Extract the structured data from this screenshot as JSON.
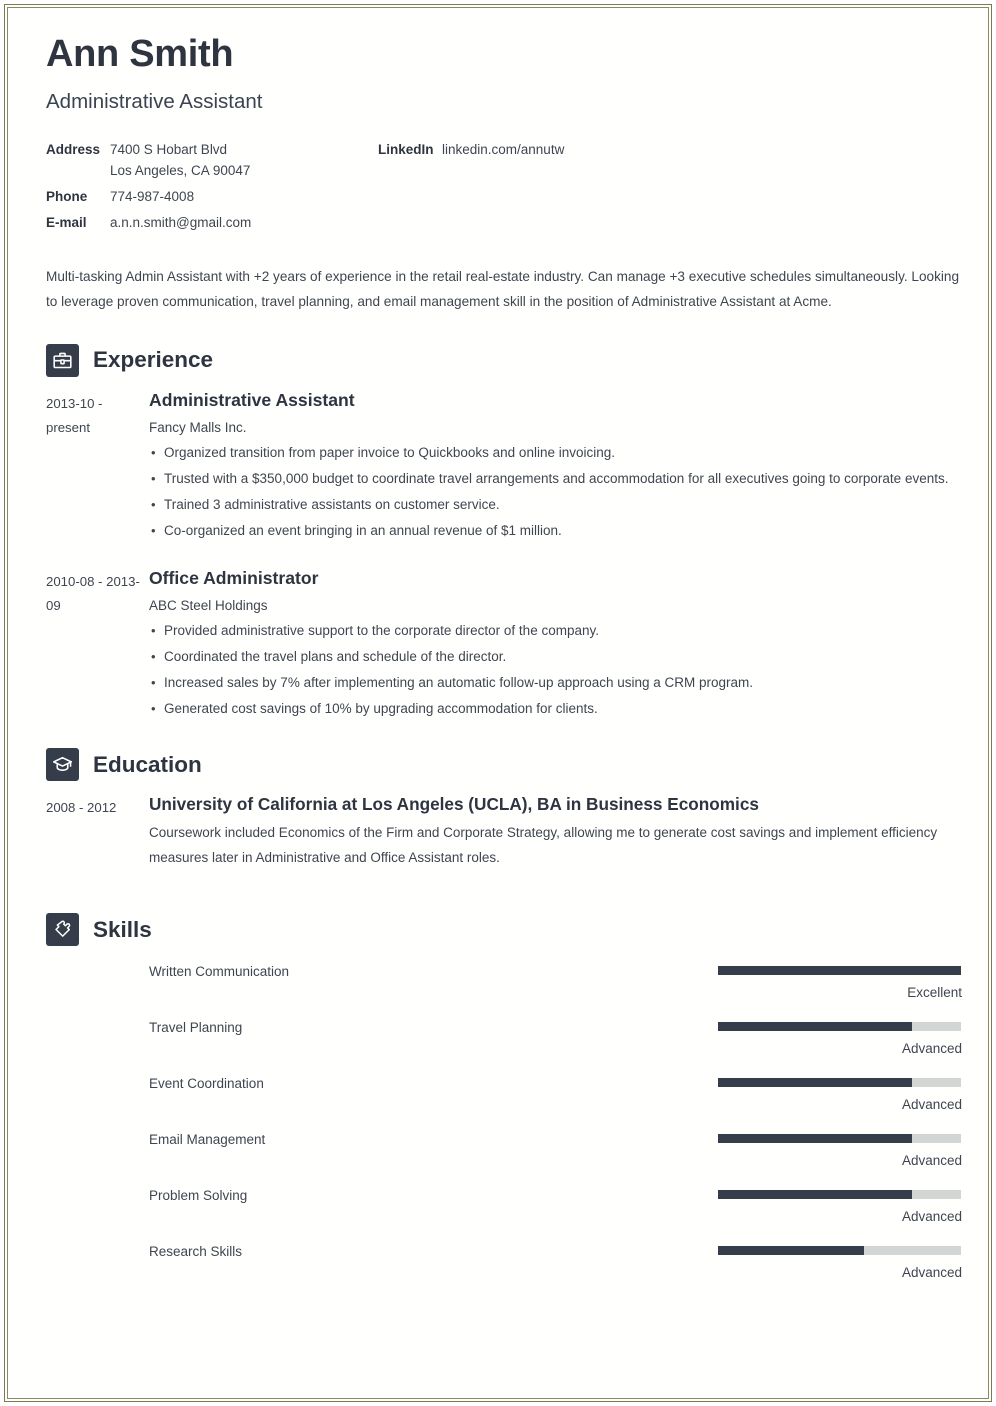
{
  "header": {
    "name": "Ann Smith",
    "job_title": "Administrative Assistant"
  },
  "contact": {
    "address_label": "Address",
    "address_line1": "7400 S Hobart Blvd",
    "address_line2": "Los Angeles, CA 90047",
    "phone_label": "Phone",
    "phone_value": "774-987-4008",
    "email_label": "E-mail",
    "email_value": "a.n.n.smith@gmail.com",
    "linkedin_label": "LinkedIn",
    "linkedin_value": "linkedin.com/annutw"
  },
  "summary": "Multi-tasking Admin Assistant with +2 years of experience in the retail real-estate industry. Can manage +3 executive schedules simultaneously. Looking to leverage proven communication, travel planning, and email management skill in the position of Administrative Assistant at Acme.",
  "sections": {
    "experience": {
      "title": "Experience",
      "icon": "briefcase-icon",
      "entries": [
        {
          "dates": "2013-10 - present",
          "title": "Administrative Assistant",
          "org": "Fancy Malls Inc.",
          "bullets": [
            "Organized transition from paper invoice to Quickbooks and online invoicing.",
            "Trusted with a $350,000 budget to coordinate travel arrangements and accommodation for all executives going to corporate events.",
            "Trained 3 administrative assistants on customer service.",
            "Co-organized an event bringing in an annual revenue of $1 million."
          ]
        },
        {
          "dates": "2010-08 - 2013-09",
          "title": "Office Administrator",
          "org": "ABC Steel Holdings",
          "bullets": [
            "Provided administrative support to the corporate director of the company.",
            "Coordinated the travel plans and schedule of the director.",
            "Increased sales by 7% after implementing an automatic follow-up approach using a CRM program.",
            "Generated cost savings of 10% by upgrading accommodation for clients."
          ]
        }
      ]
    },
    "education": {
      "title": "Education",
      "icon": "graduation-cap-icon",
      "entries": [
        {
          "dates": "2008 - 2012",
          "title": "University of California at Los Angeles (UCLA), BA in Business Economics",
          "description": "Coursework included Economics of the Firm and Corporate Strategy, allowing me to generate cost savings and implement efficiency measures later in Administrative and Office Assistant roles."
        }
      ]
    },
    "skills": {
      "title": "Skills",
      "icon": "puzzle-piece-icon",
      "items": [
        {
          "name": "Written Communication",
          "level": "Excellent",
          "percent": 100
        },
        {
          "name": "Travel Planning",
          "level": "Advanced",
          "percent": 80
        },
        {
          "name": "Event Coordination",
          "level": "Advanced",
          "percent": 80
        },
        {
          "name": "Email Management",
          "level": "Advanced",
          "percent": 80
        },
        {
          "name": "Problem Solving",
          "level": "Advanced",
          "percent": 80
        },
        {
          "name": "Research Skills",
          "level": "Advanced",
          "percent": 60
        }
      ]
    }
  },
  "colors": {
    "accent_dark": "#353d4a",
    "text_heading": "#2e3440",
    "text_body": "#3f4550",
    "bar_track": "#d4d6d6",
    "page_border": "#7c7a52"
  }
}
